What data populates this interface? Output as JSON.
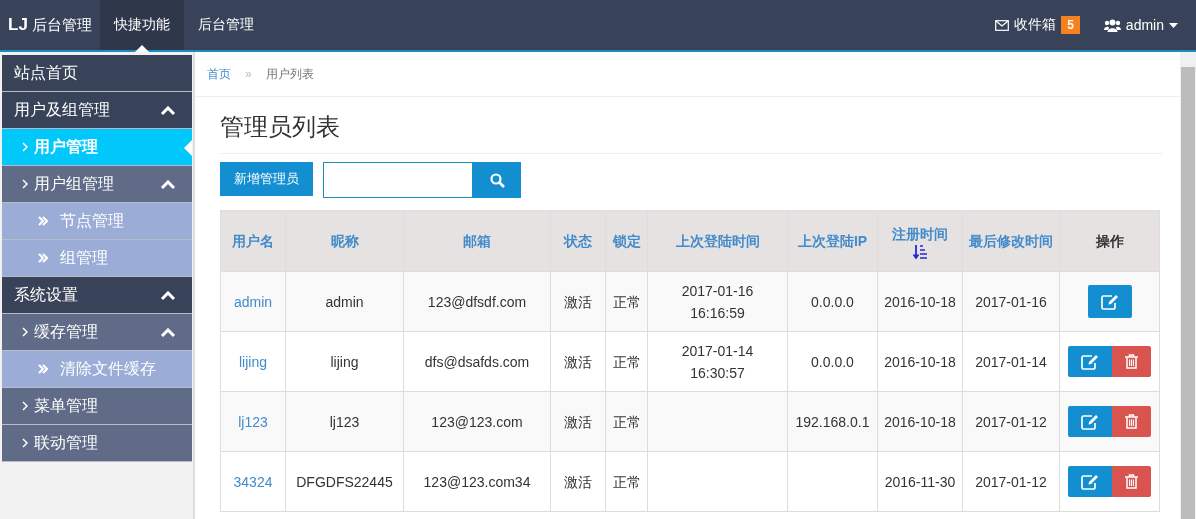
{
  "navbar": {
    "brand": {
      "logo": "LJ",
      "title": "后台管理"
    },
    "items": [
      {
        "label": "快捷功能",
        "selected": true
      },
      {
        "label": "后台管理",
        "selected": false
      }
    ],
    "inbox": {
      "label": "收件箱",
      "count": "5"
    },
    "user": {
      "name": "admin"
    }
  },
  "sidebar": {
    "items": [
      {
        "label": "站点首页",
        "selected": false
      },
      {
        "label": "用户及组管理",
        "selected": false,
        "expanded": true,
        "children": [
          {
            "label": "用户管理",
            "selected": true
          },
          {
            "label": "用户组管理",
            "selected": false,
            "expanded": true,
            "children": [
              {
                "label": "节点管理",
                "selected": false
              },
              {
                "label": "组管理",
                "selected": false
              }
            ]
          }
        ]
      },
      {
        "label": "系统设置",
        "selected": false,
        "expanded": true,
        "children": [
          {
            "label": "缓存管理",
            "selected": false,
            "expanded": true,
            "children": [
              {
                "label": "清除文件缓存",
                "selected": false
              }
            ]
          },
          {
            "label": "菜单管理",
            "selected": false
          },
          {
            "label": "联动管理",
            "selected": false
          }
        ]
      }
    ]
  },
  "breadcrumb": {
    "items": [
      "首页",
      "用户列表"
    ],
    "separator": "»"
  },
  "page": {
    "title": "管理员列表",
    "add_button": "新增管理员"
  },
  "table": {
    "columns": [
      {
        "label": "用户名",
        "kind": "link"
      },
      {
        "label": "昵称",
        "kind": "link"
      },
      {
        "label": "邮箱",
        "kind": "link"
      },
      {
        "label": "状态",
        "kind": "link"
      },
      {
        "label": "锁定",
        "kind": "link"
      },
      {
        "label": "上次登陆时间",
        "kind": "link"
      },
      {
        "label": "上次登陆IP",
        "kind": "link"
      },
      {
        "label": "注册时间",
        "kind": "link",
        "sorted": true
      },
      {
        "label": "最后修改时间",
        "kind": "link"
      },
      {
        "label": "操作",
        "kind": "plain"
      }
    ],
    "rows": [
      {
        "cells": [
          "admin",
          "admin",
          "123@dfsdf.com",
          "激活",
          "正常",
          "2017-01-16 16:16:59",
          "0.0.0.0",
          "2016-10-18",
          "2017-01-16"
        ],
        "actions": [
          {
            "kind": "edit"
          }
        ]
      },
      {
        "cells": [
          "lijing",
          "lijing",
          "dfs@dsafds.com",
          "激活",
          "正常",
          "2017-01-14 16:30:57",
          "0.0.0.0",
          "2016-10-18",
          "2017-01-14"
        ],
        "actions": [
          {
            "kind": "edit"
          },
          {
            "kind": "delete"
          }
        ]
      },
      {
        "cells": [
          "lj123",
          "lj123",
          "123@123.com",
          "激活",
          "正常",
          "",
          "192.168.0.1",
          "2016-10-18",
          "2017-01-12"
        ],
        "actions": [
          {
            "kind": "edit"
          },
          {
            "kind": "delete"
          }
        ]
      },
      {
        "cells": [
          "34324",
          "DFGDFS22445",
          "123@123.com34",
          "激活",
          "正常",
          "",
          "",
          "2016-11-30",
          "2017-01-12"
        ],
        "actions": [
          {
            "kind": "edit"
          },
          {
            "kind": "delete"
          }
        ]
      }
    ]
  }
}
